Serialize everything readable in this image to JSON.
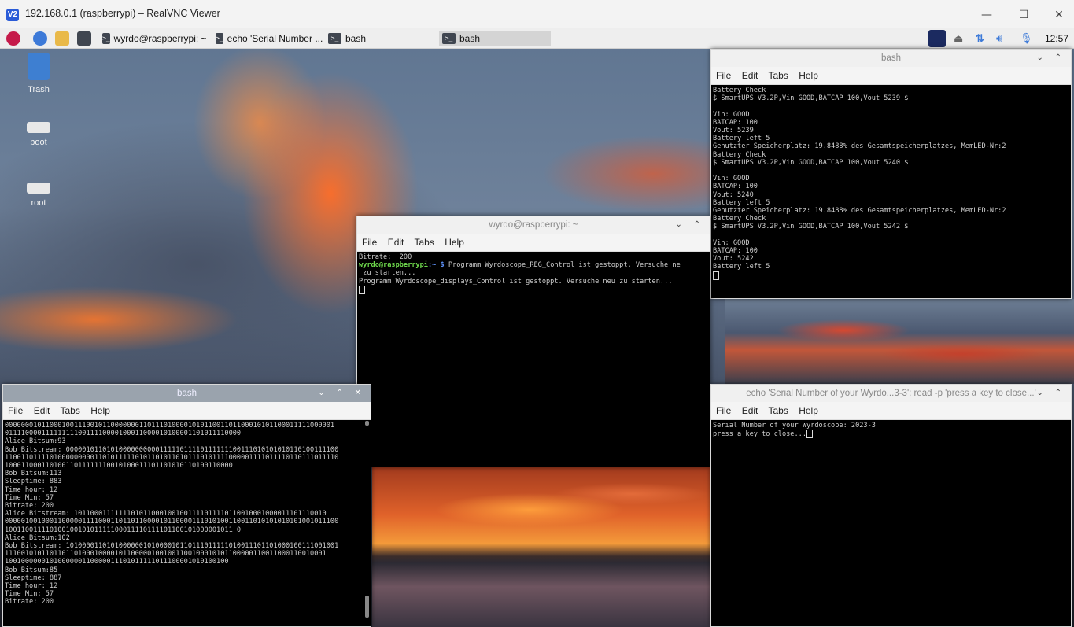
{
  "vnc": {
    "title": "192.168.0.1 (raspberrypi) – RealVNC Viewer",
    "minimize": "—",
    "maximize": "☐",
    "close": "✕"
  },
  "panel": {
    "tasks": [
      {
        "label": "wyrdo@raspberrypi: ~"
      },
      {
        "label": "echo 'Serial Number ..."
      },
      {
        "label": "bash"
      },
      {
        "label": "bash"
      }
    ],
    "clock": "12:57"
  },
  "desktop_icons": [
    {
      "label": "Trash",
      "icon": "trash-icon"
    },
    {
      "label": "boot",
      "icon": "drive-icon"
    },
    {
      "label": "root",
      "icon": "drive-icon"
    }
  ],
  "menu": {
    "file": "File",
    "edit": "Edit",
    "tabs": "Tabs",
    "help": "Help"
  },
  "term_bash_right": {
    "title": "bash",
    "lines": [
      "Battery Check",
      "$ SmartUPS V3.2P,Vin GOOD,BATCAP 100,Vout 5239 $",
      "",
      "Vin: GOOD",
      "BATCAP: 100",
      "Vout: 5239",
      "Battery left 5",
      "Genutzter Speicherplatz: 19.8488% des Gesamtspeicherplatzes, MemLED-Nr:2",
      "Battery Check",
      "$ SmartUPS V3.2P,Vin GOOD,BATCAP 100,Vout 5240 $",
      "",
      "Vin: GOOD",
      "BATCAP: 100",
      "Vout: 5240",
      "Battery left 5",
      "Genutzter Speicherplatz: 19.8488% des Gesamtspeicherplatzes, MemLED-Nr:2",
      "Battery Check",
      "$ SmartUPS V3.2P,Vin GOOD,BATCAP 100,Vout 5242 $",
      "",
      "Vin: GOOD",
      "BATCAP: 100",
      "Vout: 5242",
      "Battery left 5"
    ]
  },
  "term_wyrdo": {
    "title": "wyrdo@raspberrypi: ~",
    "line1": "Bitrate:  200",
    "prompt_user": "wyrdo@raspberrypi",
    "prompt_path": ":~ $",
    "command": " Programm Wyrdoscope_REG_Control ist gestoppt. Versuche ne",
    "line3": " zu starten...",
    "line4": "Programm Wyrdoscope_displays_Control ist gestoppt. Versuche neu zu starten..."
  },
  "term_bash_left": {
    "title": "bash",
    "lines": [
      "000000010110001001110010110000000110111010000101011001101100010101100011111000001",
      "0111100001111111110011110000100011000010100001101011110000",
      "Alice Bitsum:93",
      "Bob Bitstream: 0000010110101000000000011111011110111111100111010101010110100111100",
      "1100110111101000000000110101111101011010110101110101111000001111011110110111011110",
      "10001100011010011011111110010100011101101010110100110000",
      "Bob Bitsum:113",
      "Sleeptime: 883",
      "Time hour: 12",
      "Time Min: 57",
      "Bitrate: 200",
      "Alice Bitstream: 10110001111111010110001001001111011110110010001000011101110010",
      "0000010010001100000111100011011011000010110000111010100110011010101010101001011100",
      "10011001111010010010101111100011110111101100101000001011 0",
      "Alice Bitsum:102",
      "Bob Bitstream: 1010000110101000000101000010110111011111010011101101000100111001001",
      "1110010101101101101000100001011000001001001100100010101100000110011000110010001",
      "1001000000101000000110000011101011111011100001010100100",
      "Bob Bitsum:85",
      "Sleeptime: 887",
      "Time hour: 12",
      "Time Min: 57",
      "Bitrate: 200"
    ]
  },
  "term_echo": {
    "title": "echo 'Serial Number of your Wyrdo...3-3'; read -p 'press a key to close...'",
    "line1": "Serial Number of your Wyrdoscope: 2023-3",
    "line2": "press a key to close..."
  },
  "colors": {
    "prompt_user": "#6ed84c",
    "prompt_path": "#5a8cf0",
    "terminal_bg": "#000000",
    "terminal_text": "#cfcfcf"
  }
}
